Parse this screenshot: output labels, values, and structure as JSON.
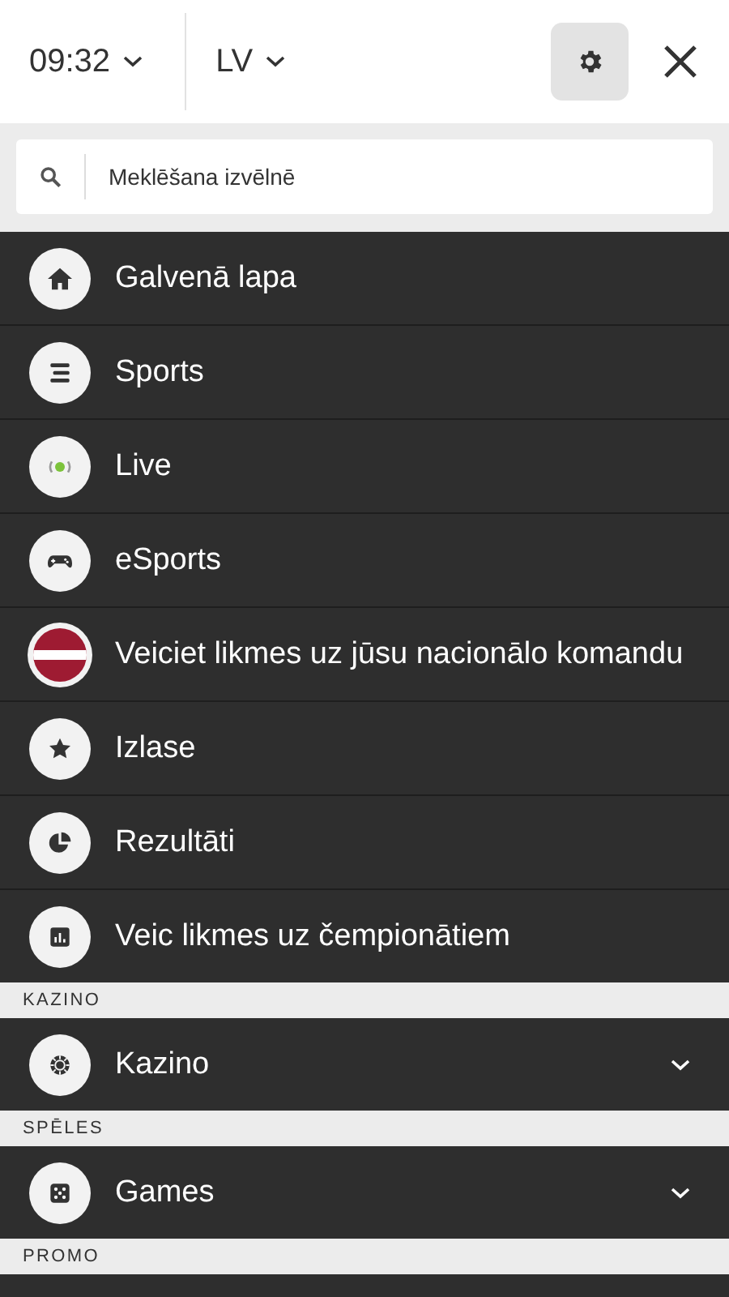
{
  "header": {
    "time": "09:32",
    "language": "LV"
  },
  "search": {
    "placeholder": "Meklēšana izvēlnē"
  },
  "sections": [
    {
      "items": [
        {
          "kind": "home",
          "label": "Galvenā lapa",
          "expandable": false
        },
        {
          "kind": "lines",
          "label": "Sports",
          "expandable": false
        },
        {
          "kind": "live",
          "label": "Live",
          "expandable": false
        },
        {
          "kind": "gamepad",
          "label": "eSports",
          "expandable": false
        },
        {
          "kind": "flag",
          "label": "Veiciet likmes uz jūsu nacionālo komandu",
          "expandable": false
        },
        {
          "kind": "star",
          "label": "Izlase",
          "expandable": false
        },
        {
          "kind": "pie",
          "label": "Rezultāti",
          "expandable": false
        },
        {
          "kind": "chart",
          "label": "Veic likmes uz čempionātiem",
          "expandable": false
        }
      ]
    },
    {
      "heading": "KAZINO",
      "items": [
        {
          "kind": "chip",
          "label": "Kazino",
          "expandable": true
        }
      ]
    },
    {
      "heading": "SPĒLES",
      "items": [
        {
          "kind": "dice",
          "label": "Games",
          "expandable": true
        }
      ]
    },
    {
      "heading": "PROMO"
    }
  ]
}
